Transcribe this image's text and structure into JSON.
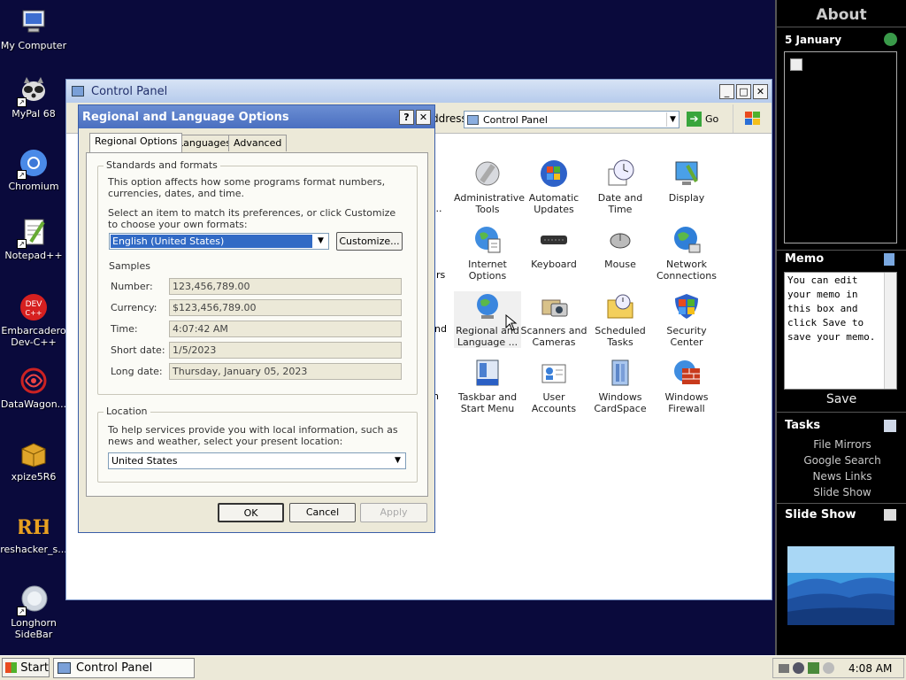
{
  "desktop": {
    "icons": [
      {
        "label": "My Computer"
      },
      {
        "label": "MyPal 68"
      },
      {
        "label": "Chromium"
      },
      {
        "label": "Notepad++"
      },
      {
        "label": "Embarcadero Dev-C++"
      },
      {
        "label": "DataWagon..."
      },
      {
        "label": "xpize5R6"
      },
      {
        "label": "reshacker_s..."
      },
      {
        "label": "Longhorn SideBar"
      }
    ]
  },
  "control_panel": {
    "title": "Control Panel",
    "address_label": "ddress",
    "address_value": "Control Panel",
    "go_label": "Go",
    "partial_texts": [
      "...",
      "rs",
      "nd",
      "n"
    ],
    "items": [
      {
        "label": "Administrative Tools",
        "icon": "administrative-tools"
      },
      {
        "label": "Automatic Updates",
        "icon": "automatic-updates"
      },
      {
        "label": "Date and Time",
        "icon": "date-and-time"
      },
      {
        "label": "Display",
        "icon": "display"
      },
      {
        "label": "Internet Options",
        "icon": "internet-options"
      },
      {
        "label": "Keyboard",
        "icon": "keyboard"
      },
      {
        "label": "Mouse",
        "icon": "mouse"
      },
      {
        "label": "Network Connections",
        "icon": "network-connections"
      },
      {
        "label": "Regional and Language ...",
        "icon": "regional-language"
      },
      {
        "label": "Scanners and Cameras",
        "icon": "scanners-cameras"
      },
      {
        "label": "Scheduled Tasks",
        "icon": "scheduled-tasks"
      },
      {
        "label": "Security Center",
        "icon": "security-center"
      },
      {
        "label": "Taskbar and Start Menu",
        "icon": "taskbar-start-menu"
      },
      {
        "label": "User Accounts",
        "icon": "user-accounts"
      },
      {
        "label": "Windows CardSpace",
        "icon": "windows-cardspace"
      },
      {
        "label": "Windows Firewall",
        "icon": "windows-firewall"
      }
    ]
  },
  "dialog": {
    "title": "Regional and Language Options",
    "help": "?",
    "close": "✕",
    "tabs": [
      "Regional Options",
      "Languages",
      "Advanced"
    ],
    "standards": {
      "legend": "Standards and formats",
      "desc": "This option affects how some programs format numbers, currencies, dates, and time.",
      "select_prompt": "Select an item to match its preferences, or click Customize to choose your own formats:",
      "selected_format": "English (United States)",
      "customize": "Customize...",
      "samples_label": "Samples",
      "samples": [
        {
          "label": "Number:",
          "value": "123,456,789.00"
        },
        {
          "label": "Currency:",
          "value": "$123,456,789.00"
        },
        {
          "label": "Time:",
          "value": "4:07:42 AM"
        },
        {
          "label": "Short date:",
          "value": "1/5/2023"
        },
        {
          "label": "Long date:",
          "value": "Thursday, January 05, 2023"
        }
      ]
    },
    "location": {
      "legend": "Location",
      "desc": "To help services provide you with local information, such as news and weather, select your present location:",
      "value": "United States"
    },
    "ok": "OK",
    "cancel": "Cancel",
    "apply": "Apply"
  },
  "sidebar": {
    "about": "About",
    "date": "5 January",
    "memo_title": "Memo",
    "memo_text": "You can edit your memo in this box and click Save to save your memo.",
    "save": "Save",
    "tasks_title": "Tasks",
    "tasks": [
      "File Mirrors",
      "Google Search",
      "News Links",
      "Slide Show"
    ],
    "slideshow_title": "Slide Show"
  },
  "taskbar": {
    "start": "Start",
    "task": "Control Panel",
    "clock": "4:08 AM"
  }
}
